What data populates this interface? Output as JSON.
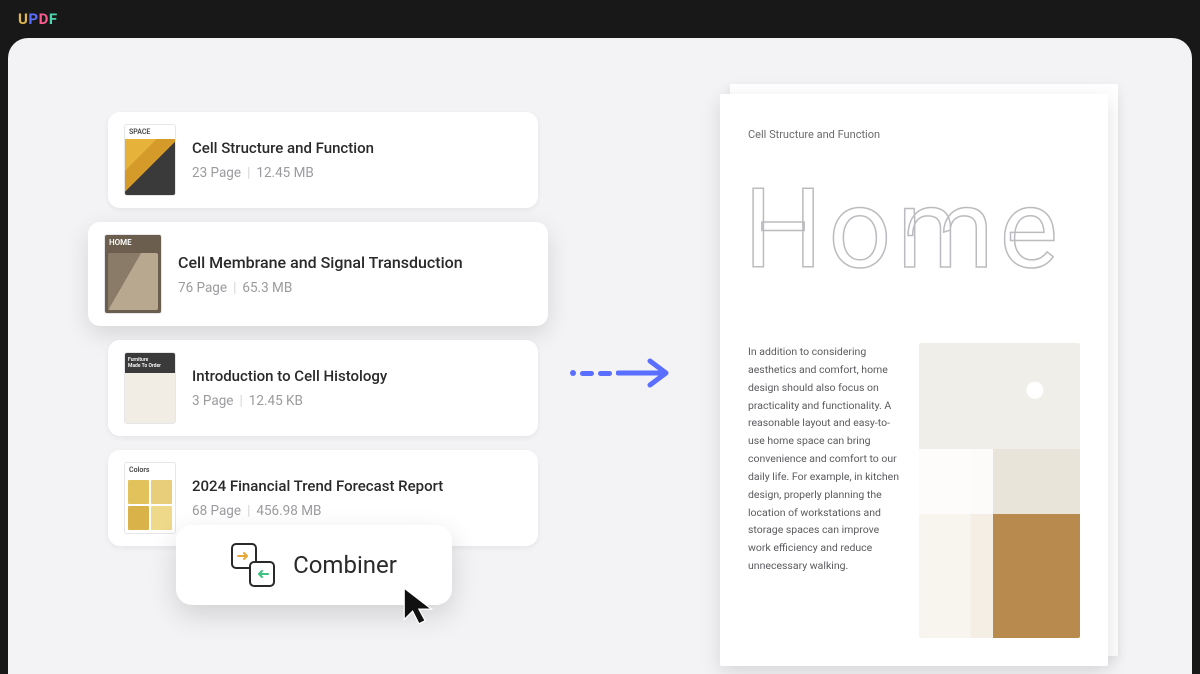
{
  "logo": {
    "c1": "U",
    "c2": "P",
    "c3": "D",
    "c4": "F"
  },
  "files": [
    {
      "thumb_label": "SPACE",
      "title": "Cell Structure and Function",
      "pages": "23 Page",
      "size": "12.45 MB"
    },
    {
      "thumb_label": "HOME",
      "title": "Cell Membrane and Signal Transduction",
      "pages": "76 Page",
      "size": "65.3 MB"
    },
    {
      "thumb_label": "",
      "title": "Introduction to Cell Histology",
      "pages": "3 Page",
      "size": "12.45 KB"
    },
    {
      "thumb_label": "Colors",
      "title": "2024 Financial Trend Forecast Report",
      "pages": "68 Page",
      "size": "456.98 MB"
    }
  ],
  "combiner": {
    "label": "Combiner"
  },
  "preview": {
    "doc_title": "Cell Structure and  Function",
    "hero": "Home",
    "body": "In addition to considering aesthetics and comfort, home design should also focus on practicality and functionality. A reasonable layout and easy-to-use home space can bring convenience and comfort to our daily life. For example, in kitchen design, properly planning the location of workstations and storage spaces can improve work efficiency and reduce unnecessary walking."
  }
}
